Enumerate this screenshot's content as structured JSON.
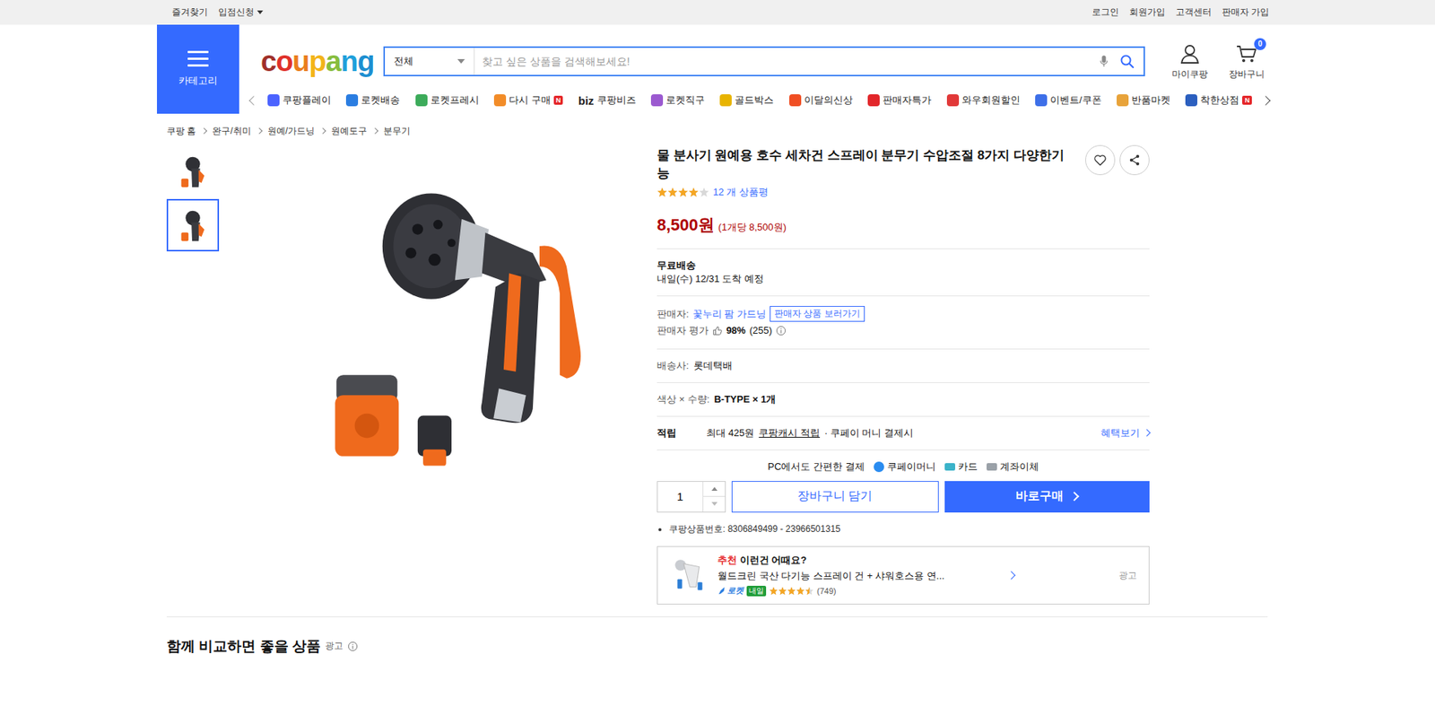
{
  "top_bar": {
    "left": [
      {
        "label": "즐겨찾기",
        "dropdown": false
      },
      {
        "label": "입점신청",
        "dropdown": true
      }
    ],
    "right": [
      "로그인",
      "회원가입",
      "고객센터",
      "판매자 가입"
    ]
  },
  "header": {
    "category_button": "카테고리",
    "logo": "coupang",
    "search": {
      "scope": "전체",
      "placeholder": "찾고 싶은 상품을 검색해보세요!"
    },
    "my_coupang": "마이쿠팡",
    "cart": {
      "label": "장바구니",
      "count": "0"
    }
  },
  "nav": [
    {
      "label": "쿠팡플레이",
      "kind": "icon",
      "prefix": "",
      "badge": "",
      "color": "#4b63ff"
    },
    {
      "label": "로켓배송",
      "kind": "icon",
      "prefix": "",
      "badge": "",
      "color": "#2a7de1"
    },
    {
      "label": "로켓프레시",
      "kind": "icon",
      "prefix": "",
      "badge": "",
      "color": "#3cab5a"
    },
    {
      "label": "다시 구매",
      "kind": "icon",
      "prefix": "",
      "badge": "N",
      "color": "#f28c28"
    },
    {
      "label": "쿠팡비즈",
      "kind": "wordmark",
      "prefix": "biz",
      "badge": "",
      "color": "#222222"
    },
    {
      "label": "로켓직구",
      "kind": "icon",
      "prefix": "",
      "badge": "",
      "color": "#9b59d0"
    },
    {
      "label": "골드박스",
      "kind": "icon",
      "prefix": "",
      "badge": "",
      "color": "#e8b400"
    },
    {
      "label": "이달의신상",
      "kind": "icon",
      "prefix": "",
      "badge": "",
      "color": "#f04e23"
    },
    {
      "label": "판매자특가",
      "kind": "icon",
      "prefix": "",
      "badge": "",
      "color": "#e2262a"
    },
    {
      "label": "와우회원할인",
      "kind": "icon",
      "prefix": "",
      "badge": "",
      "color": "#e13838"
    },
    {
      "label": "이벤트/쿠폰",
      "kind": "icon",
      "prefix": "",
      "badge": "",
      "color": "#3d6fe8"
    },
    {
      "label": "반품마켓",
      "kind": "icon",
      "prefix": "",
      "badge": "",
      "color": "#e8a33a"
    },
    {
      "label": "착한상점",
      "kind": "icon",
      "prefix": "",
      "badge": "N",
      "color": "#2b5fbf"
    }
  ],
  "breadcrumb": [
    "쿠팡 홈",
    "완구/취미",
    "원예/가드닝",
    "원예도구",
    "분무기"
  ],
  "gallery": {
    "thumbnails": [
      {
        "selected": false
      },
      {
        "selected": true
      }
    ]
  },
  "product": {
    "title": "물 분사기 원예용 호수 세차건 스프레이 분무기 수압조절 8가지 다양한기능",
    "stars": 4,
    "review_count": "12 개 상품평",
    "price": "8,500원",
    "unit_price": "(1개당 8,500원)",
    "shipping": {
      "label": "무료배송",
      "arrival": "내일(수) 12/31 도착 예정"
    },
    "seller": {
      "label": "판매자:",
      "name": "꽃누리 팜 가드닝",
      "shop_button": "판매자 상품 보러가기",
      "rating_label": "판매자 평가",
      "rating": "98%",
      "rating_count": "(255)"
    },
    "carrier": {
      "label": "배송사:",
      "value": "롯데택배"
    },
    "option": {
      "label": "색상 × 수량:",
      "value": "B-TYPE × 1개"
    },
    "reward": {
      "label": "적립",
      "amount": "최대 425원",
      "link": "쿠팡캐시 적립",
      "condition": "· 쿠페이 머니 결제시",
      "benefits": "혜택보기"
    },
    "payment": {
      "label": "PC에서도 간편한 결제",
      "methods": [
        {
          "label": "쿠페이머니",
          "color": "#2a8cf0"
        },
        {
          "label": "카드",
          "color": "#3bb3c9"
        },
        {
          "label": "계좌이체",
          "color": "#9aa1a8"
        }
      ]
    },
    "quantity": "1",
    "add_to_cart": "장바구니 담기",
    "buy_now": "바로구매",
    "product_number": "쿠팡상품번호: 8306849499 - 23966501315"
  },
  "recommendation": {
    "tag": "추천",
    "title": "이런건 어때요?",
    "name": "월드크린 국산 다기능 스프레이 건 + 샤워호스용 연...",
    "delivery": "로켓",
    "arrival": "내일",
    "stars": 4.5,
    "review_count": "(749)",
    "ad_label": "광고"
  },
  "compare_section": {
    "title": "함께 비교하면 좋을 상품",
    "ad_label": "광고"
  }
}
